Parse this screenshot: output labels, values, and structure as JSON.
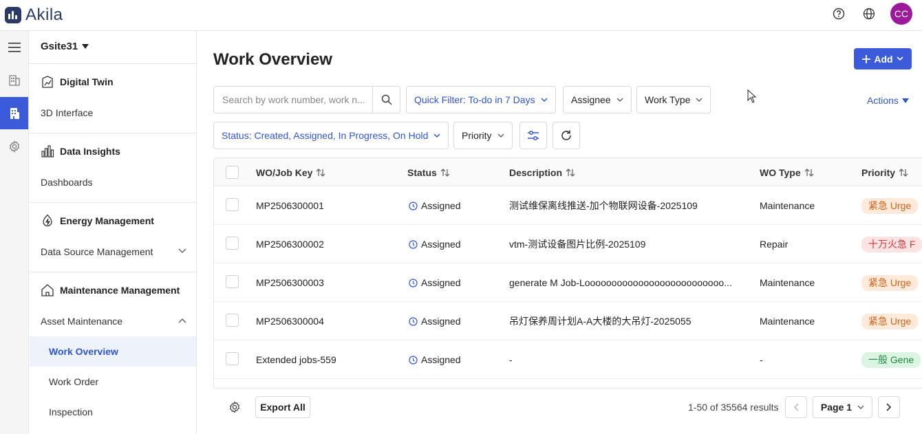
{
  "app": {
    "logo_text": "Akila"
  },
  "header": {
    "avatar_initials": "CC"
  },
  "nav": {
    "site": "Gsite31",
    "sections": [
      {
        "title": "Digital Twin",
        "links": [
          "3D Interface"
        ]
      },
      {
        "title": "Data Insights",
        "links": [
          "Dashboards"
        ]
      },
      {
        "title": "Energy Management",
        "links": [
          "Data Source Management"
        ]
      },
      {
        "title": "Maintenance Management",
        "group": "Asset Maintenance",
        "subitems": [
          "Work Overview",
          "Work Order",
          "Inspection"
        ]
      }
    ]
  },
  "page": {
    "title": "Work Overview",
    "add_label": "Add",
    "actions_label": "Actions"
  },
  "filters": {
    "search_placeholder": "Search by work number, work n...",
    "quick_filter": "Quick Filter: To-do in 7 Days",
    "assignee": "Assignee",
    "work_type": "Work Type",
    "status": "Status: Created, Assigned, In Progress, On Hold",
    "priority": "Priority"
  },
  "table": {
    "columns": [
      "WO/Job Key",
      "Status",
      "Description",
      "WO Type",
      "Priority"
    ],
    "rows": [
      {
        "key": "MP2506300001",
        "status": "Assigned",
        "description": "测试维保离线推送-加个物联网设备-2025109",
        "type": "Maintenance",
        "priority": "紧急 Urge",
        "priority_color": "orange"
      },
      {
        "key": "MP2506300002",
        "status": "Assigned",
        "description": "vtm-测试设备图片比例-2025109",
        "type": "Repair",
        "priority": "十万火急 F",
        "priority_color": "red"
      },
      {
        "key": "MP2506300003",
        "status": "Assigned",
        "description": "generate M Job-Loooooooooooooooooooooooooo...",
        "type": "Maintenance",
        "priority": "紧急 Urge",
        "priority_color": "orange"
      },
      {
        "key": "MP2506300004",
        "status": "Assigned",
        "description": "吊灯保养周计划A-A大楼的大吊灯-2025055",
        "type": "Maintenance",
        "priority": "紧急 Urge",
        "priority_color": "orange"
      },
      {
        "key": "Extended jobs-559",
        "status": "Assigned",
        "description": "-",
        "type": "-",
        "priority": "一般 Gene",
        "priority_color": "green"
      }
    ]
  },
  "footer": {
    "export_label": "Export All",
    "results": "1-50 of 35564 results",
    "page_label": "Page 1"
  },
  "colors": {
    "accent": "#3b5bdb",
    "brand": "#2b3a67",
    "avatar": "#9b1a9b"
  }
}
